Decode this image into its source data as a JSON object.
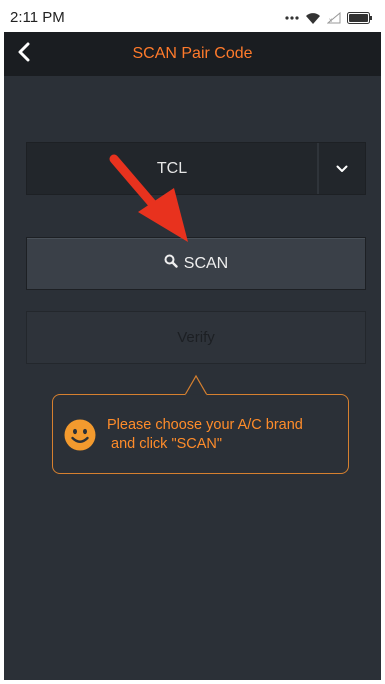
{
  "status_bar": {
    "time": "2:11 PM",
    "icons": [
      "more-dots-icon",
      "wifi-icon",
      "signal-icon",
      "battery-icon"
    ]
  },
  "header": {
    "back_icon": "chevron-left-icon",
    "title": "SCAN Pair Code"
  },
  "brand_select": {
    "value": "TCL",
    "icon": "chevron-down-icon"
  },
  "scan_button": {
    "label": "SCAN",
    "icon": "search-icon"
  },
  "verify_button": {
    "label": "Verify"
  },
  "tooltip": {
    "icon": "smiley-icon",
    "line1": "Please choose your A/C brand",
    "line2": "and click \"SCAN\""
  },
  "colors": {
    "background": "#2b3037",
    "header": "#1a1d21",
    "accent": "#ff7a2b",
    "annotation": "#e8321e"
  }
}
